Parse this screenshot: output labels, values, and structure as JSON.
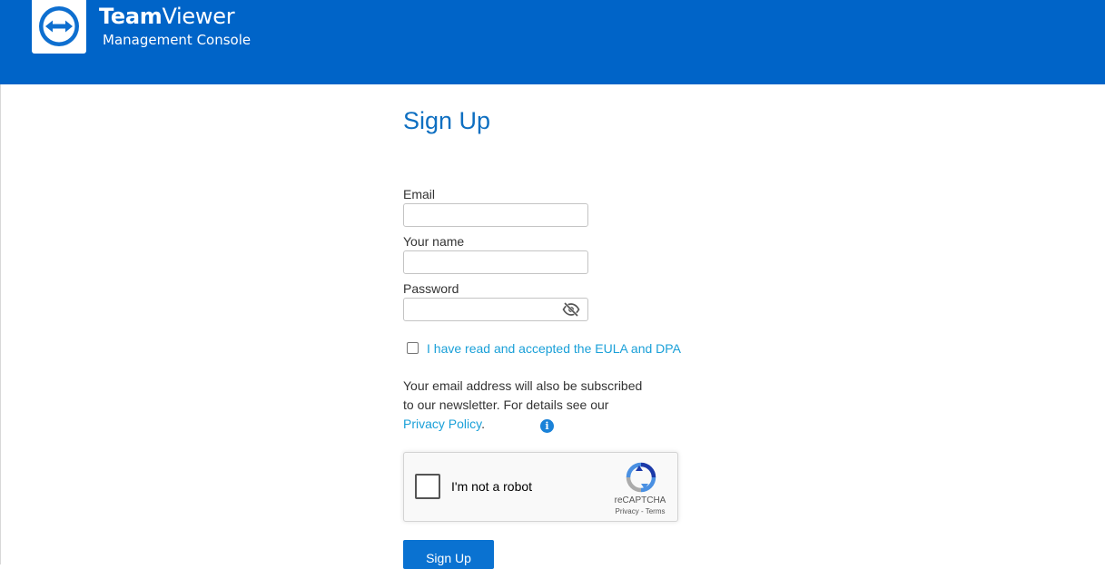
{
  "header": {
    "brand_bold": "Team",
    "brand_regular": "Viewer",
    "brand_subtitle": "Management Console",
    "logo_icon": "teamviewer-logo-icon",
    "background_color": "#0064c8"
  },
  "form": {
    "title": "Sign Up",
    "email": {
      "label": "Email",
      "value": "",
      "placeholder": ""
    },
    "name": {
      "label": "Your name",
      "value": "",
      "placeholder": ""
    },
    "password": {
      "label": "Password",
      "value": "",
      "placeholder": "",
      "toggle_icon": "eye-slash-icon"
    },
    "eula": {
      "checked": false,
      "label": "I have read and accepted the EULA and DPA"
    },
    "newsletter": {
      "text_before": "Your email address will also be subscribed to our newsletter. For details see our ",
      "link": "Privacy Policy",
      "text_after": ".",
      "info_icon": "info-icon"
    },
    "captcha": {
      "label": "I'm not a robot",
      "brand": "reCAPTCHA",
      "privacy": "Privacy",
      "separator": " - ",
      "terms": "Terms",
      "logo_icon": "recaptcha-logo-icon"
    },
    "submit_label": "Sign Up"
  },
  "colors": {
    "title": "#0e6fc1",
    "link": "#1aa0d8",
    "button": "#0a72d1"
  }
}
